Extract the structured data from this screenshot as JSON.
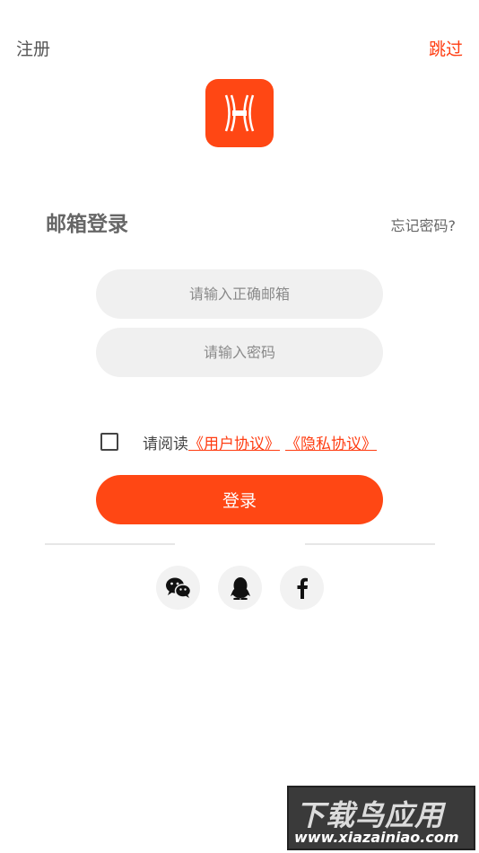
{
  "header": {
    "register_label": "注册",
    "skip_label": "跳过"
  },
  "login": {
    "title": "邮箱登录",
    "forgot_label": "忘记密码?",
    "email_placeholder": "请输入正确邮箱",
    "password_placeholder": "请输入密码",
    "agreement_prefix": "请阅读",
    "user_agreement_label": "《用户协议》",
    "privacy_agreement_label": "《隐私协议》",
    "agreement_checked": false,
    "submit_label": "登录"
  },
  "social": {
    "icons": [
      "wechat-icon",
      "qq-icon",
      "facebook-icon"
    ]
  },
  "watermark": {
    "title": "下载鸟应用",
    "url": "www.xiazainiao.com"
  },
  "colors": {
    "accent": "#ff4714",
    "link": "#ff3d12",
    "field_bg": "#f0f0f0"
  }
}
